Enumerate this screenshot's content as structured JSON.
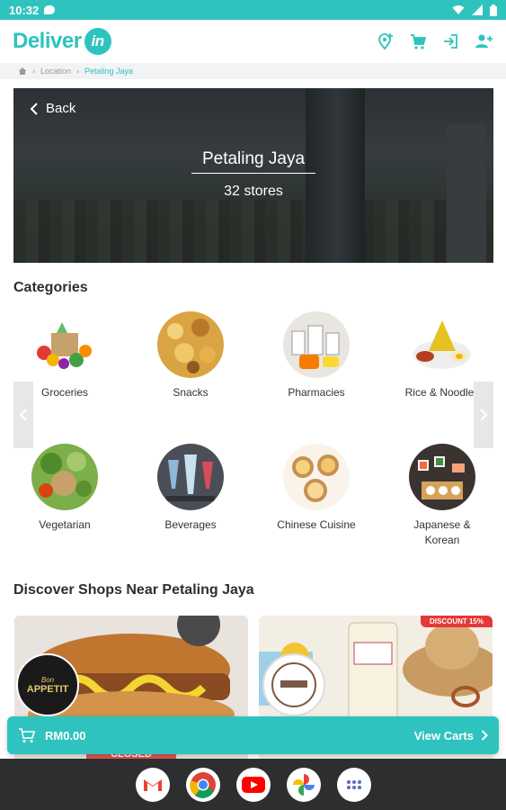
{
  "status_bar": {
    "time": "10:32"
  },
  "header": {
    "logo_main": "Deliver",
    "logo_suffix": "in"
  },
  "breadcrumb": {
    "items": [
      "Location",
      "Petaling Jaya"
    ]
  },
  "hero": {
    "back_label": "Back",
    "title": "Petaling Jaya",
    "subtitle": "32 stores"
  },
  "categories": {
    "title": "Categories",
    "items": [
      {
        "label": "Groceries",
        "icon": "groceries-icon"
      },
      {
        "label": "Snacks",
        "icon": "snacks-icon"
      },
      {
        "label": "Pharmacies",
        "icon": "pharmacies-icon"
      },
      {
        "label": "Rice & Noodles",
        "icon": "rice-noodles-icon"
      },
      {
        "label": "Vegetarian",
        "icon": "vegetarian-icon"
      },
      {
        "label": "Beverages",
        "icon": "beverages-icon"
      },
      {
        "label": "Chinese Cuisine",
        "icon": "chinese-cuisine-icon"
      },
      {
        "label": "Japanese &",
        "label2": "Korean",
        "icon": "japanese-korean-icon"
      }
    ]
  },
  "discover": {
    "title": "Discover Shops Near Petaling Jaya",
    "shops": [
      {
        "logo_small": "Bon",
        "logo_text": "APPETIT",
        "status": "CLOSED"
      },
      {
        "discount": "DISCOUNT 15%"
      }
    ]
  },
  "cart": {
    "amount": "RM0.00",
    "view_label": "View Carts"
  },
  "colors": {
    "accent": "#2fc3bf",
    "status_bar": "#2fc3bf",
    "nav_bar": "#2d2e30"
  }
}
